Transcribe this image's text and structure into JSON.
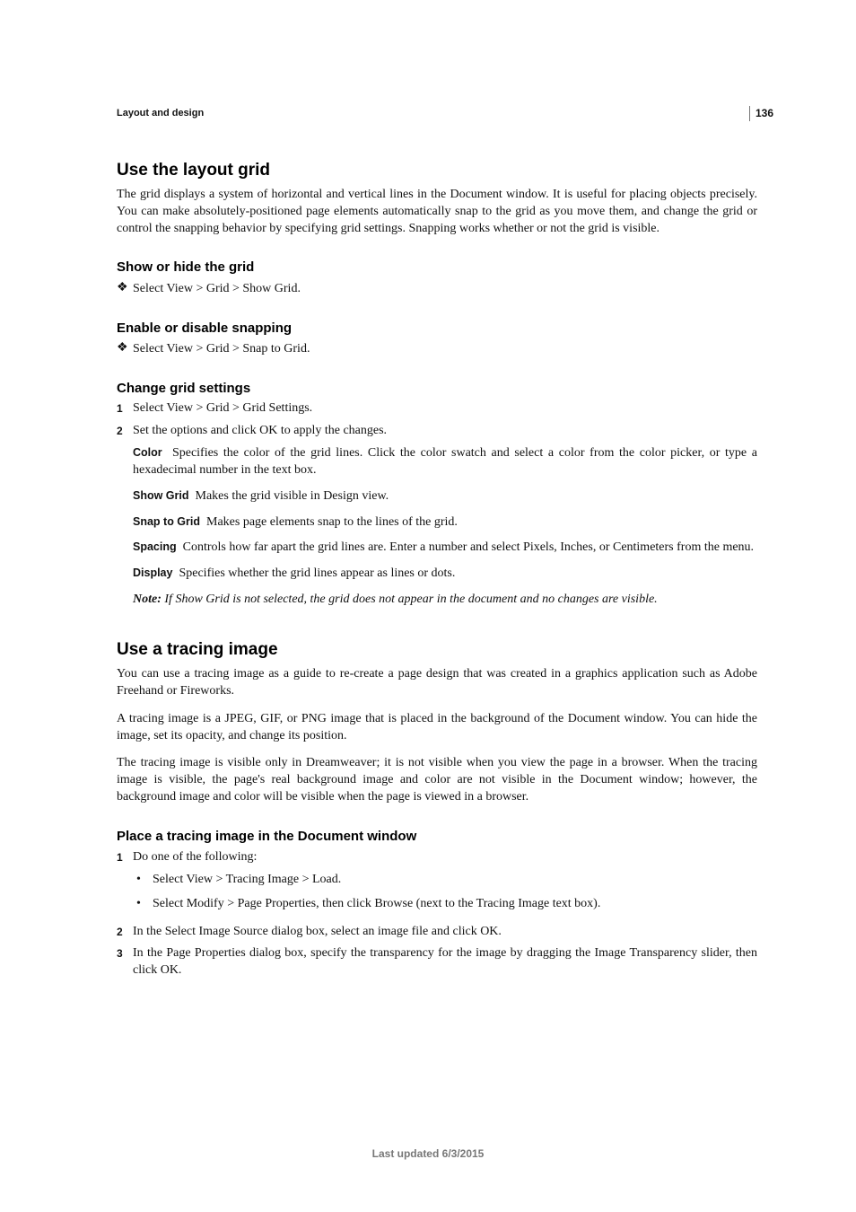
{
  "page_number": "136",
  "chapter": "Layout and design",
  "section1": {
    "title": "Use the layout grid",
    "intro": "The grid displays a system of horizontal and vertical lines in the Document window. It is useful for placing objects precisely. You can make absolutely-positioned page elements automatically snap to the grid as you move them, and change the grid or control the snapping behavior by specifying grid settings. Snapping works whether or not the grid is visible.",
    "sub1": {
      "title": "Show or hide the grid",
      "item": "Select View > Grid > Show Grid."
    },
    "sub2": {
      "title": "Enable or disable snapping",
      "item": "Select View > Grid > Snap to Grid."
    },
    "sub3": {
      "title": "Change grid settings",
      "step1": "Select View > Grid > Grid Settings.",
      "step2": "Set the options and click OK to apply the changes.",
      "defs": {
        "color_term": "Color",
        "color_desc": "Specifies the color of the grid lines. Click the color swatch and select a color from the color picker, or type a hexadecimal number in the text box.",
        "showgrid_term": "Show Grid",
        "showgrid_desc": "Makes the grid visible in Design view.",
        "snap_term": "Snap to Grid",
        "snap_desc": "Makes page elements snap to the lines of the grid.",
        "spacing_term": "Spacing",
        "spacing_desc": "Controls how far apart the grid lines are. Enter a number and select Pixels, Inches, or Centimeters from the menu.",
        "display_term": "Display",
        "display_desc": "Specifies whether the grid lines appear as lines or dots."
      },
      "note_label": "Note:",
      "note_text": "If Show Grid is not selected, the grid does not appear in the document and no changes are visible."
    }
  },
  "section2": {
    "title": "Use a tracing image",
    "p1": "You can use a tracing image as a guide to re-create a page design that was created in a graphics application such as Adobe Freehand or Fireworks.",
    "p2": "A tracing image is a JPEG, GIF, or PNG image that is placed in the background of the Document window. You can hide the image, set its opacity, and change its position.",
    "p3": "The tracing image is visible only in Dreamweaver; it is not visible when you view the page in a browser. When the tracing image is visible, the page's real background image and color are not visible in the Document window; however, the background image and color will be visible when the page is viewed in a browser.",
    "sub1": {
      "title": "Place a tracing image in the Document window",
      "step1": "Do one of the following:",
      "bullets": {
        "b1": "Select View > Tracing Image > Load.",
        "b2": "Select Modify > Page Properties, then click Browse (next to the Tracing Image text box)."
      },
      "step2": "In the Select Image Source dialog box, select an image file and click OK.",
      "step3": "In the Page Properties dialog box, specify the transparency for the image by dragging the Image Transparency slider, then click OK."
    }
  },
  "footer": "Last updated 6/3/2015"
}
